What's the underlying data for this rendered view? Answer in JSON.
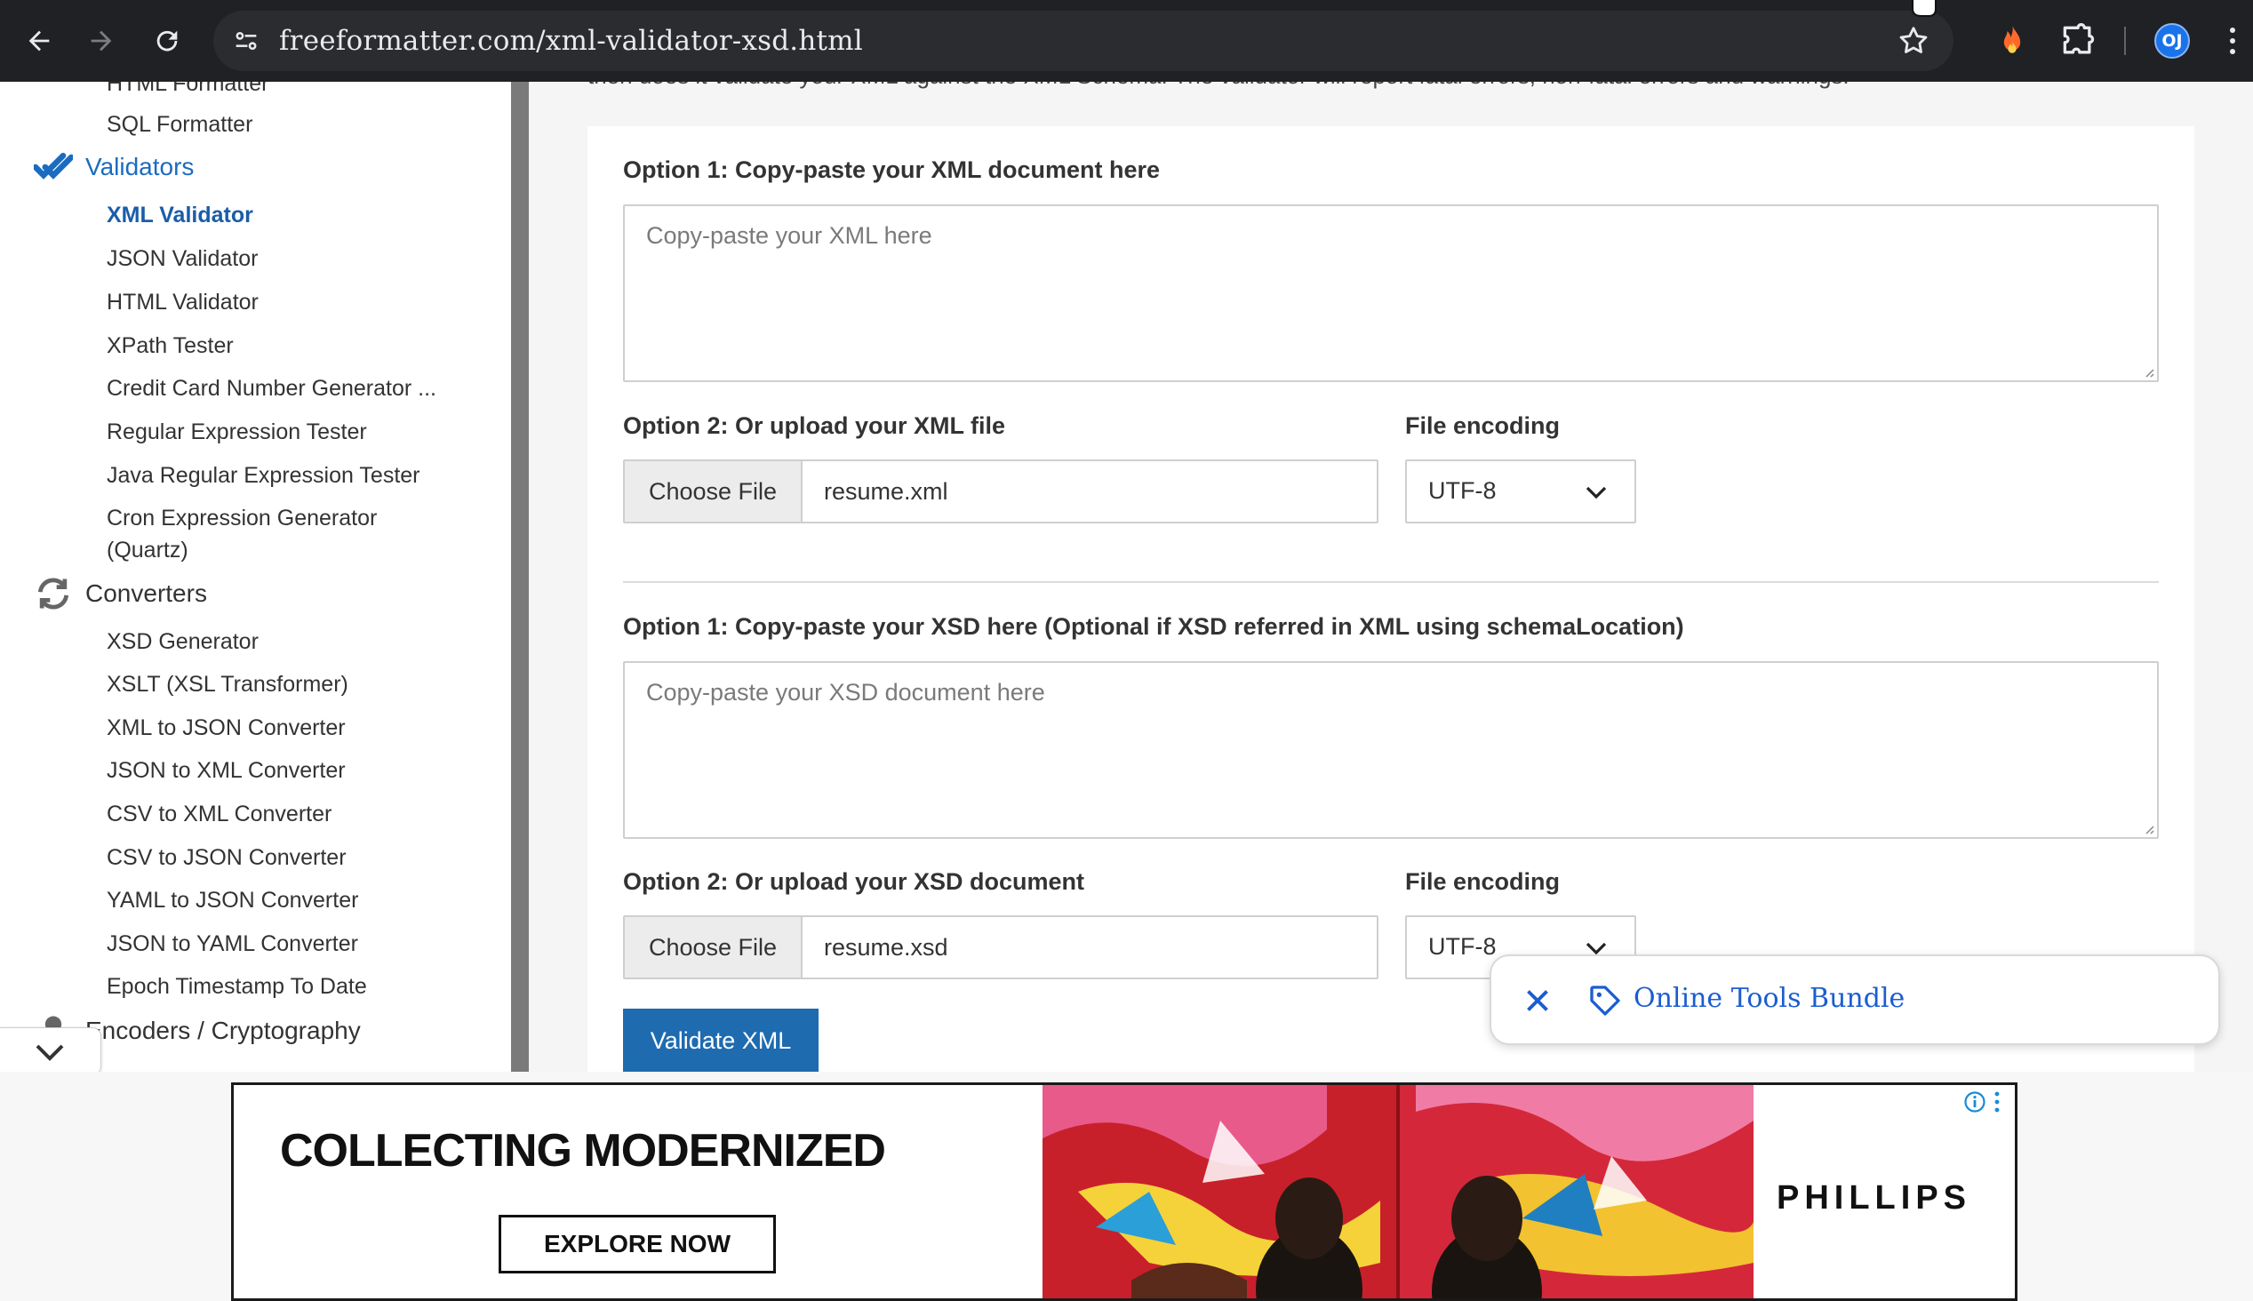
{
  "browser": {
    "url": "freeformatter.com/xml-validator-xsd.html",
    "profile_initials": "OJ"
  },
  "sidebar": {
    "clipped_top_item": "HTML Formatter",
    "sql_formatter": "SQL Formatter",
    "validators": {
      "heading": "Validators",
      "items": [
        "XML Validator",
        "JSON Validator",
        "HTML Validator",
        "XPath Tester",
        "Credit Card Number Generator ...",
        "Regular Expression Tester",
        "Java Regular Expression Tester",
        "Cron Expression Generator",
        "(Quartz)"
      ]
    },
    "converters": {
      "heading": "Converters",
      "items": [
        "XSD Generator",
        "XSLT (XSL Transformer)",
        "XML to JSON Converter",
        "JSON to XML Converter",
        "CSV to XML Converter",
        "CSV to JSON Converter",
        "YAML to JSON Converter",
        "JSON to YAML Converter",
        "Epoch Timestamp To Date"
      ]
    },
    "encoders_heading": "Encoders / Cryptography"
  },
  "main": {
    "clipped_intro": "then does it validate your XML against the XML Schema. The validator will report fatal errors, non-fatal errors and warnings.",
    "xml": {
      "paste_label": "Option 1: Copy-paste your XML document here",
      "paste_placeholder": "Copy-paste your XML here",
      "upload_label": "Option 2: Or upload your XML file",
      "choose_file": "Choose File",
      "file_name": "resume.xml",
      "encoding_label": "File encoding",
      "encoding_value": "UTF-8"
    },
    "xsd": {
      "paste_label": "Option 1: Copy-paste your XSD here (Optional if XSD referred in XML using schemaLocation)",
      "paste_placeholder": "Copy-paste your XSD document here",
      "upload_label": "Option 2: Or upload your XSD document",
      "choose_file": "Choose File",
      "file_name": "resume.xsd",
      "encoding_label": "File encoding",
      "encoding_value": "UTF-8"
    },
    "validate_button": "Validate XML"
  },
  "popup": {
    "label": "Online Tools Bundle"
  },
  "ad": {
    "headline": "COLLECTING MODERNIZED",
    "cta": "EXPLORE NOW",
    "brand": "PHILLIPS"
  },
  "colors": {
    "toolbar_bg": "#202124",
    "link_blue": "#1a6cc0",
    "button_blue": "#1e6bb0"
  }
}
